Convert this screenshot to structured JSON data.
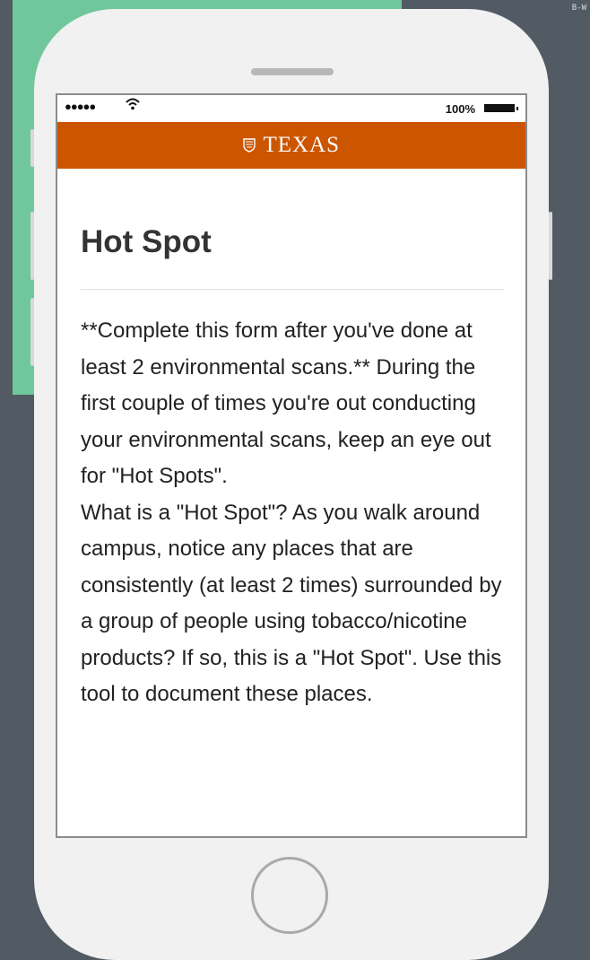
{
  "corner_label": "B-W",
  "status_bar": {
    "signal": "●●●●●",
    "wifi": "ᯤ",
    "battery_percent": "100%"
  },
  "header": {
    "logo_text": "TEXAS",
    "brand_color": "#cc5500"
  },
  "page": {
    "title": "Hot Spot",
    "paragraph_1": "**Complete this form after you've done at least 2 environmental scans.** During the first couple of times you're out conducting your environmental scans, keep an eye out for \"Hot Spots\".",
    "paragraph_2": "What is a \"Hot Spot\"? As you walk around campus, notice any places that are consistently (at least 2 times) surrounded by a group of people using tobacco/nicotine products? If so, this is a \"Hot Spot\". Use this tool to document these places."
  }
}
